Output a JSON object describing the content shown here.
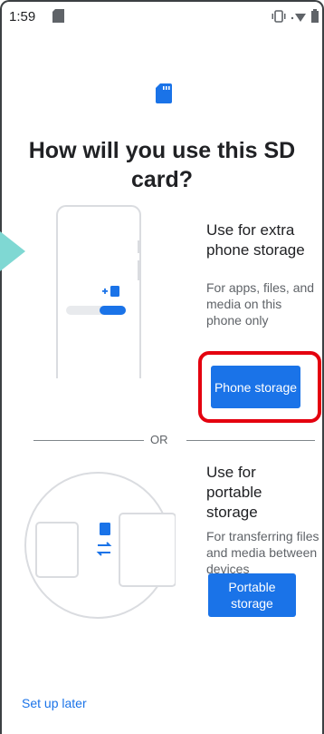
{
  "status_bar": {
    "time": "1:59",
    "icons": [
      "sd-card-icon",
      "vibrate-icon",
      "wifi-icon",
      "battery-icon"
    ]
  },
  "title": "How will you use this SD card?",
  "option_phone": {
    "heading": "Use for extra phone storage",
    "description": "For apps, files, and media on this phone only",
    "button_label": "Phone storage"
  },
  "divider_label": "OR",
  "option_portable": {
    "heading": "Use for portable storage",
    "description": "For transferring files and media between devices",
    "button_label": "Portable storage"
  },
  "setup_later": "Set up later",
  "colors": {
    "accent": "#1a73e8",
    "highlight": "#e4000f",
    "arrow": "#7fd8d3",
    "illustration": "#dadce0"
  }
}
